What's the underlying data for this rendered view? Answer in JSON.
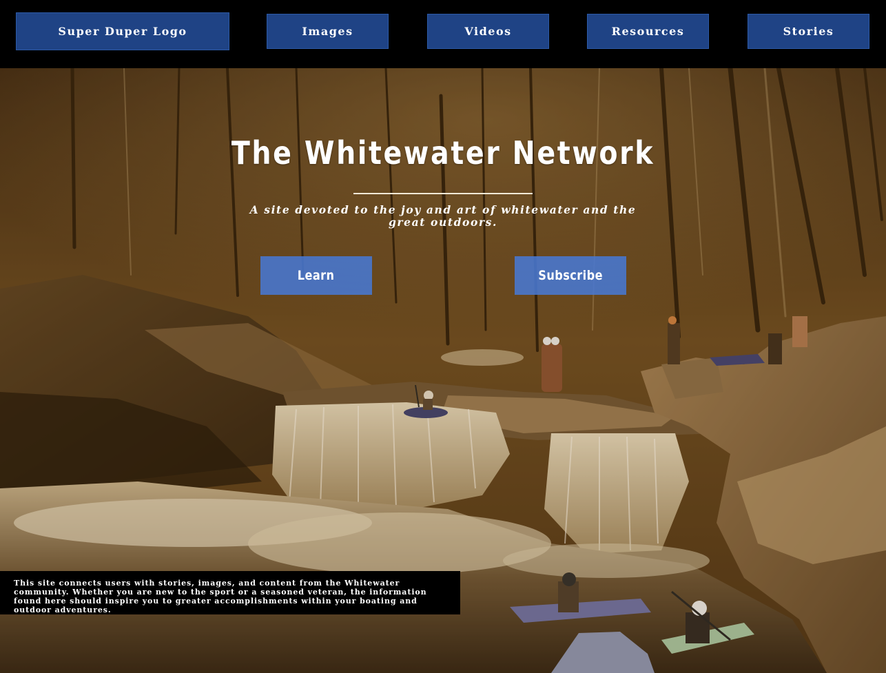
{
  "nav": {
    "logo_label": "Super Duper Logo",
    "items": [
      {
        "label": "Images"
      },
      {
        "label": "Videos"
      },
      {
        "label": "Resources"
      },
      {
        "label": "Stories"
      }
    ]
  },
  "hero": {
    "title": "The Whitewater Network",
    "subtitle": "A site devoted to the joy and art of whitewater and the great outdoors.",
    "buttons": {
      "learn_label": "Learn",
      "subscribe_label": "Subscribe"
    },
    "blurb": "This site connects users with stories, images, and content from the Whitewater community. Whether you are new to the sport or a seasoned veteran, the information found here should inspire you to greater accomplishments within your boating and outdoor adventures."
  },
  "colors": {
    "nav_button": "#1f4385",
    "cta_button": "#4878d2",
    "header_bg": "#000000",
    "photo_tone": "#6b4a1a"
  },
  "icons": {
    "background_photo": "whitewater-kayak-waterfall-photo"
  }
}
